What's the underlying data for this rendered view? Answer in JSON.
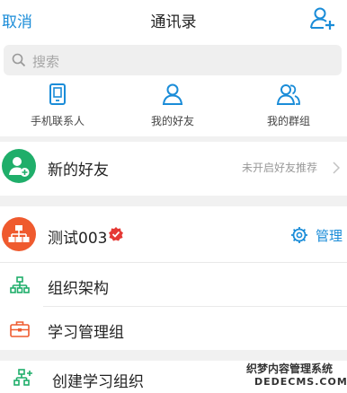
{
  "header": {
    "cancel_label": "取消",
    "title": "通讯录"
  },
  "search": {
    "placeholder": "搜索"
  },
  "quick_actions": [
    {
      "label": "手机联系人",
      "icon": "phone-icon"
    },
    {
      "label": "我的好友",
      "icon": "person-icon"
    },
    {
      "label": "我的群组",
      "icon": "group-icon"
    }
  ],
  "new_friends": {
    "label": "新的好友",
    "status": "未开启好友推荐"
  },
  "organization": {
    "name": "测试003",
    "manage_label": "管理"
  },
  "org_items": [
    {
      "label": "组织架构",
      "icon": "org-chart-icon"
    },
    {
      "label": "学习管理组",
      "icon": "briefcase-icon"
    }
  ],
  "create_org": {
    "label": "创建学习组织"
  },
  "watermark": {
    "line1": "织梦内容管理系统",
    "line2": "DEDECMS.COM"
  },
  "colors": {
    "accent": "#1a8cd8",
    "green": "#1fae6a",
    "orange": "#ef5a2e",
    "red": "#e53935"
  }
}
